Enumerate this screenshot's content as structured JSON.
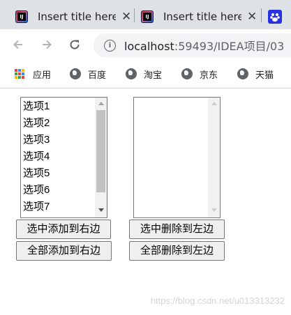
{
  "browser": {
    "tabs": [
      {
        "title": "Insert title here",
        "close": "✕"
      },
      {
        "title": "Insert title here",
        "close": "✕"
      }
    ],
    "url_host": "localhost",
    "url_path": ":59493/IDEA项目/03"
  },
  "bookmarks": [
    "应用",
    "百度",
    "淘宝",
    "京东",
    "天猫"
  ],
  "left_list": {
    "options": [
      "选项1",
      "选项2",
      "选项3",
      "选项4",
      "选项5",
      "选项6",
      "选项7"
    ]
  },
  "right_list": {
    "options": []
  },
  "buttons": {
    "add_selected": "选中添加到右边",
    "add_all": "全部添加到右边",
    "remove_selected": "选中删除到左边",
    "remove_all": "全部删除到左边"
  },
  "watermark": "https://blog.csdn.net/u013313232",
  "colors": {
    "tab_bar": "#dee1e6",
    "button_bg": "#efefef",
    "scroll_thumb": "#c1c1c1"
  }
}
